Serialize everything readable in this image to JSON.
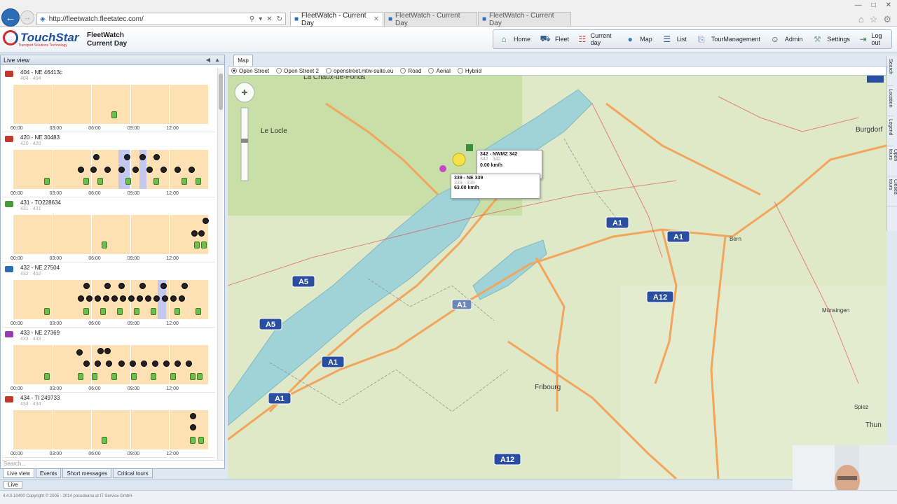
{
  "browser": {
    "address": "http://fleetwatch.fleetatec.com/",
    "tabs": [
      {
        "label": "FleetWatch - Current Day",
        "active": true
      },
      {
        "label": "FleetWatch - Current Day",
        "active": false
      },
      {
        "label": "FleetWatch - Current Day",
        "active": false
      }
    ]
  },
  "app": {
    "brand": "TouchStar",
    "brand_sub": "Transport Solutions Technology",
    "title": "FleetWatch",
    "subtitle": "Current Day",
    "toolbar": [
      {
        "label": "Home",
        "icon": "home-icon",
        "color": "#4a8f3a"
      },
      {
        "label": "Fleet",
        "icon": "truck-icon",
        "color": "#3b5f8c"
      },
      {
        "label": "Current day",
        "icon": "calendar-icon",
        "color": "#c0392b"
      },
      {
        "label": "Map",
        "icon": "globe-icon",
        "color": "#2e7fc1"
      },
      {
        "label": "List",
        "icon": "list-icon",
        "color": "#2c5a8a"
      },
      {
        "label": "TourManagement",
        "icon": "clipboard-icon",
        "color": "#6b8bb0"
      },
      {
        "label": "Admin",
        "icon": "user-icon",
        "color": "#345"
      },
      {
        "label": "Settings",
        "icon": "wrench-icon",
        "color": "#8a9bb0"
      },
      {
        "label": "Log out",
        "icon": "logout-icon",
        "color": "#3a8f4a"
      }
    ]
  },
  "left_panel": {
    "title": "Live view",
    "time_ticks": [
      "00:00",
      "03:00",
      "06:00",
      "09:00",
      "12:00"
    ],
    "search_placeholder": "Search...",
    "vehicles": [
      {
        "name": "404 - NE 46413c",
        "sub": "404 · 404",
        "color": "#c0392b"
      },
      {
        "name": "420 - NE 30483",
        "sub": "420 · 420",
        "color": "#c0392b"
      },
      {
        "name": "431 - TO228634",
        "sub": "431 · 431",
        "color": "#4a9a3a"
      },
      {
        "name": "432 - NE 27504",
        "sub": "432 · 432",
        "color": "#2e6bb5"
      },
      {
        "name": "433 - NE 27369",
        "sub": "433 · 433",
        "color": "#9b3ab5"
      },
      {
        "name": "434 - TI 249733",
        "sub": "434 · 434",
        "color": "#c0392b"
      }
    ],
    "bottom_tabs": [
      "Live view",
      "Events",
      "Short messages",
      "Critical tours"
    ],
    "live_button": "Live"
  },
  "map_panel": {
    "tab": "Map",
    "layers": [
      {
        "label": "Open Street",
        "selected": true
      },
      {
        "label": "Open Street 2",
        "selected": false
      },
      {
        "label": "openstreet.mtw-suite.eu",
        "selected": false
      },
      {
        "label": "Road",
        "selected": false
      },
      {
        "label": "Aerial",
        "selected": false
      },
      {
        "label": "Hybrid",
        "selected": false
      }
    ],
    "places": [
      "La Chaux-de-Fonds",
      "Le Locle",
      "Burgdorf",
      "Bern",
      "Fribourg",
      "Thun",
      "Spiez",
      "Münsingen"
    ],
    "road_shields": [
      "A1",
      "A1",
      "A5",
      "A5",
      "A1",
      "A1",
      "A12",
      "A12",
      "A1"
    ],
    "popups": [
      {
        "title": "342 - NWMZ 342",
        "sub": "342 · 342",
        "speed": "0.00 km/h"
      },
      {
        "title": "339 - NE 339",
        "sub": "339 · 339",
        "speed": "63.00 km/h"
      }
    ],
    "side_tabs": [
      "Search",
      "Location",
      "Legend",
      "Open tours",
      "Closed tours"
    ]
  },
  "status_bar": "4.4.0.10490 Copyright © 2005 - 2014 pocudeana at IT-Service GmbH"
}
